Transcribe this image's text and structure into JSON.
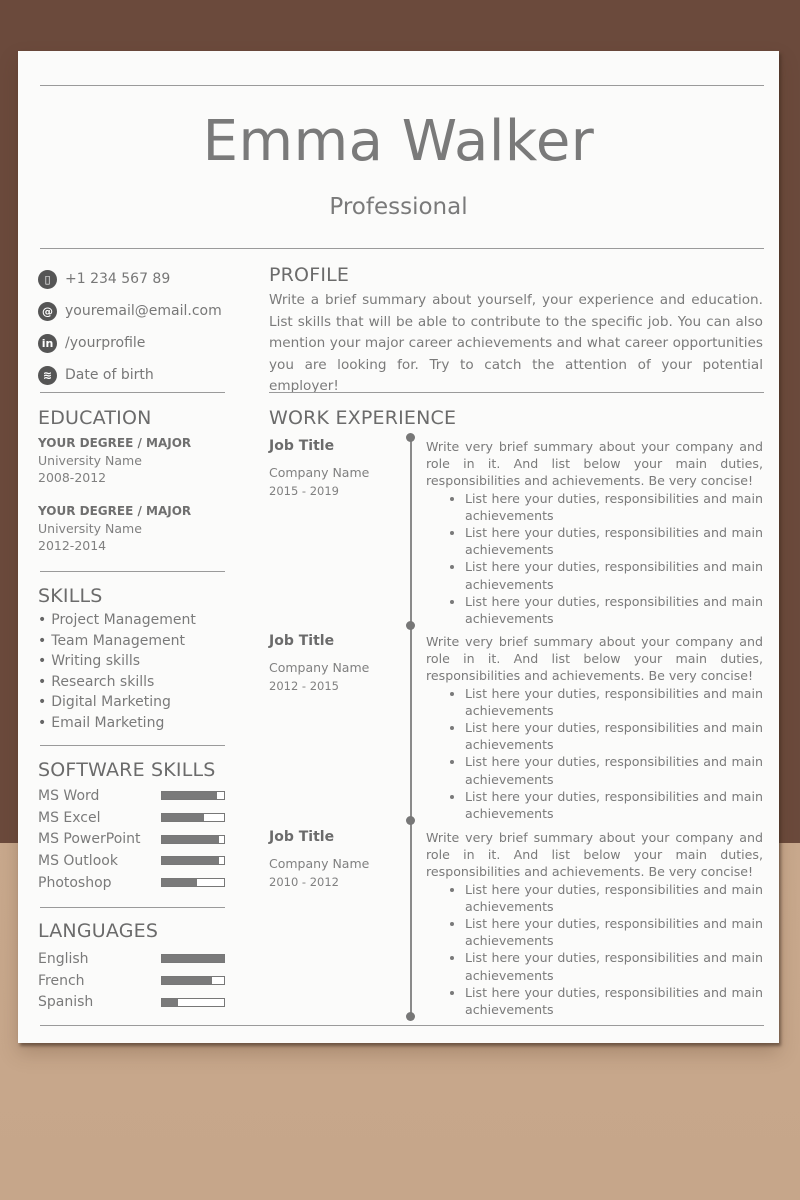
{
  "header": {
    "name": "Emma Walker",
    "title": "Professional"
  },
  "contact": [
    {
      "icon": "phone-icon",
      "glyph": "▯",
      "text": "+1 234 567 89"
    },
    {
      "icon": "email-icon",
      "glyph": "@",
      "text": "youremail@email.com"
    },
    {
      "icon": "linkedin-icon",
      "glyph": "in",
      "text": "/yourprofile"
    },
    {
      "icon": "birthday-cake-icon",
      "glyph": "≋",
      "text": "Date of birth"
    }
  ],
  "profile": {
    "heading": "PROFILE",
    "text": "Write a brief summary about yourself, your experience and education. List skills that will be able to contribute to the specific job. You can also mention your major career achievements and what career opportunities you are looking for. Try to catch the attention of your potential employer!"
  },
  "education": {
    "heading": "EDUCATION",
    "items": [
      {
        "degree": "YOUR DEGREE / MAJOR",
        "school": "University Name",
        "years": "2008-2012"
      },
      {
        "degree": "YOUR DEGREE / MAJOR",
        "school": "University Name",
        "years": "2012-2014"
      }
    ]
  },
  "skills": {
    "heading": "SKILLS",
    "items": [
      "Project Management",
      "Team Management",
      "Writing skills",
      "Research skills",
      "Digital Marketing",
      "Email Marketing"
    ]
  },
  "software_skills": {
    "heading": "SOFTWARE SKILLS",
    "items": [
      {
        "label": "MS Word",
        "level": 0.88
      },
      {
        "label": "MS Excel",
        "level": 0.68
      },
      {
        "label": "MS PowerPoint",
        "level": 0.92
      },
      {
        "label": "MS Outlook",
        "level": 0.92
      },
      {
        "label": "Photoshop",
        "level": 0.57
      }
    ]
  },
  "languages": {
    "heading": "LANGUAGES",
    "items": [
      {
        "label": "English",
        "level": 1.0
      },
      {
        "label": "French",
        "level": 0.8
      },
      {
        "label": "Spanish",
        "level": 0.25
      }
    ]
  },
  "work": {
    "heading": "WORK EXPERIENCE",
    "jobs": [
      {
        "title": "Job Title",
        "company": "Company Name",
        "dates": "2015 - 2019",
        "summary": "Write very brief summary about your company and role in it. And list below your main duties, responsibilities and achievements. Be very concise!",
        "duties": [
          "List here your duties, responsibilities and main achievements",
          "List here your duties, responsibilities and main achievements",
          "List here your duties, responsibilities and main achievements",
          "List here your duties, responsibilities and main achievements"
        ]
      },
      {
        "title": "Job Title",
        "company": "Company Name",
        "dates": "2012 - 2015",
        "summary": "Write very brief summary about your company and role in it. And list below your main duties, responsibilities and achievements. Be very concise!",
        "duties": [
          "List here your duties, responsibilities and main achievements",
          "List here your duties, responsibilities and main achievements",
          "List here your duties, responsibilities and main achievements",
          "List here your duties, responsibilities and main achievements"
        ]
      },
      {
        "title": "Job Title",
        "company": "Company Name",
        "dates": "2010 - 2012",
        "summary": "Write very brief summary about your company and role in it. And list below your main duties, responsibilities and achievements. Be very concise!",
        "duties": [
          "List here your duties, responsibilities and main achievements",
          "List here your duties, responsibilities and main achievements",
          "List here your duties, responsibilities and main achievements",
          "List here your duties, responsibilities and main achievements"
        ]
      }
    ]
  }
}
